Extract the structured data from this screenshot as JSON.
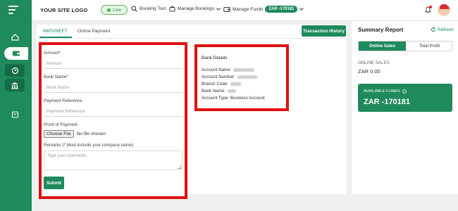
{
  "app": {
    "logo": "YOUR SITE LOGO"
  },
  "status": {
    "live": "Live"
  },
  "nav": {
    "booking_tool": "Booking Tool",
    "manage_bookings": "Manage Bookings",
    "manage_funds": "Manage Funds",
    "funds_badge": "ZAR -170181"
  },
  "tabs": {
    "imps": "IMPS/NEFT",
    "online": "Online Payment"
  },
  "actions": {
    "transaction_history": "Transaction History",
    "submit": "Submit"
  },
  "form": {
    "amount_label": "Amount*",
    "amount_placeholder": "Amount",
    "bank_label": "Bank Name*",
    "bank_placeholder": "Bank Name",
    "ref_label": "Payment Reference",
    "ref_placeholder": "Payment Reference",
    "proof_label": "Proof of Payment",
    "choose_file": "Choose File",
    "no_file": "No file chosen",
    "remarks_label": "Remarks (* Must include your company name)",
    "remarks_placeholder": "Type your comments"
  },
  "bank": {
    "title": "Bank Details",
    "account_name": "Account Name:",
    "account_number": "Account Number:",
    "branch_code": "Branch Code:",
    "bank_name": "Bank Name:",
    "account_type": "Account Type: Business Account"
  },
  "summary": {
    "title": "Summary Report",
    "refresh": "Refresh",
    "seg_online": "Online Sales",
    "seg_total": "Total Profit",
    "online_sales_label": "ONLINE SALES",
    "online_sales_value": "ZAR 0.00",
    "available_funds_label": "AVAILABLE FUNDS",
    "available_funds_value": "ZAR -170181"
  },
  "colors": {
    "brand": "#1f8a5c",
    "highlight": "#e01010"
  }
}
